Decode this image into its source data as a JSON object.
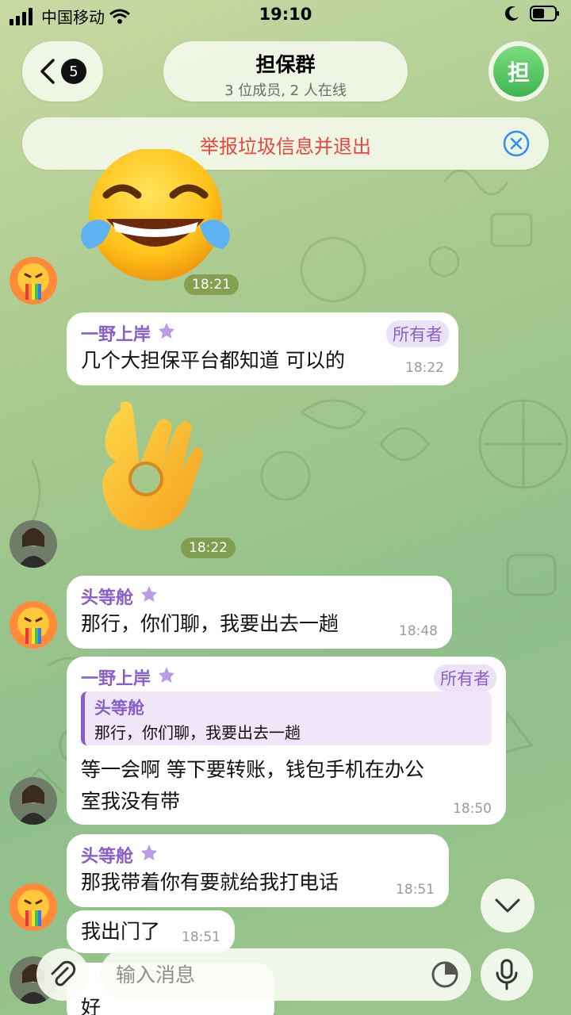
{
  "status_bar": {
    "carrier": "中国移动",
    "time": "19:10"
  },
  "header": {
    "back_badge": "5",
    "title": "担保群",
    "subtitle": "3 位成员, 2 人在线",
    "group_avatar_letter": "担"
  },
  "banner": {
    "report_text": "举报垃圾信息并退出"
  },
  "messages": [
    {
      "type": "sticker",
      "sticker": "laughing-tears-emoji",
      "time": "18:21"
    },
    {
      "type": "text",
      "sender": "一野上岸",
      "role": "所有者",
      "text": "几个大担保平台都知道 可以的",
      "time": "18:22"
    },
    {
      "type": "sticker",
      "sticker": "ok-hand-emoji",
      "time": "18:22"
    },
    {
      "type": "text",
      "sender": "头等舱",
      "text": "那行，你们聊，我要出去一趟",
      "time": "18:48"
    },
    {
      "type": "reply",
      "sender": "一野上岸",
      "role": "所有者",
      "reply_to": {
        "sender": "头等舱",
        "text": "那行，你们聊，我要出去一趟"
      },
      "text_line1": "等一会啊 等下要转账，钱包手机在办公",
      "text_line2": "室我没有带",
      "time": "18:50"
    },
    {
      "type": "text",
      "sender": "头等舱",
      "text": "那我带着你有要就给我打电话",
      "time": "18:51"
    },
    {
      "type": "text",
      "text": "我出门了",
      "time": "18:51"
    },
    {
      "type": "text",
      "text": "好",
      "time": ""
    }
  ],
  "composer": {
    "placeholder": "输入消息"
  },
  "colors": {
    "sender_name": "#8a5ec8",
    "report_text": "#e8453c",
    "online_green": "#3fb552"
  }
}
